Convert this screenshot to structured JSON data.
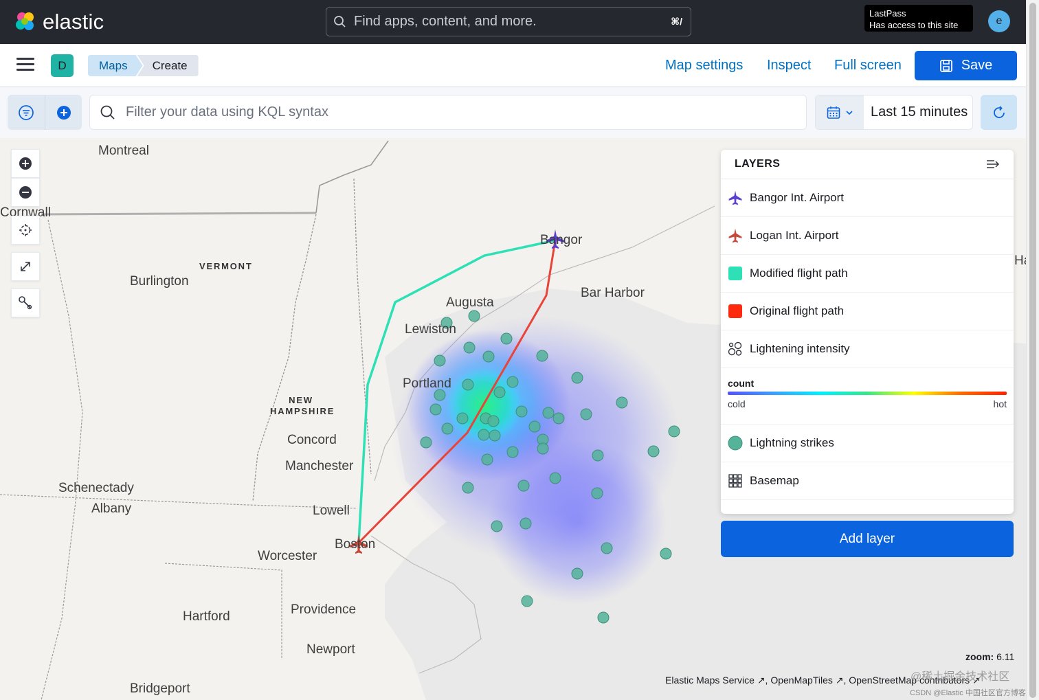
{
  "header": {
    "brand": "elastic",
    "search_placeholder": "Find apps, content, and more.",
    "search_shortcut": "⌘/",
    "lastpass_title": "LastPass",
    "lastpass_subtitle": "Has access to this site",
    "avatar_initial": "e"
  },
  "appbar": {
    "space_initial": "D",
    "breadcrumbs": [
      "Maps",
      "Create"
    ],
    "map_settings": "Map settings",
    "inspect": "Inspect",
    "full_screen": "Full screen",
    "save": "Save"
  },
  "query": {
    "kql_placeholder": "Filter your data using KQL syntax",
    "time_range": "Last 15 minutes"
  },
  "map": {
    "places": {
      "montreal": "Montreal",
      "cornwall": "Cornwall",
      "burlington": "Burlington",
      "vermont": "VERMONT",
      "new_hampshire": "NEW HAMPSHIRE",
      "concord": "Concord",
      "manchester": "Manchester",
      "schenectady": "Schenectady",
      "albany": "Albany",
      "lowell": "Lowell",
      "boston": "Boston",
      "worcester": "Worcester",
      "hartford": "Hartford",
      "providence": "Providence",
      "newport": "Newport",
      "bridgeport": "Bridgeport",
      "augusta": "Augusta",
      "lewiston": "Lewiston",
      "portland": "Portland",
      "bangor": "Bangor",
      "bar_harbor": "Bar Harbor",
      "edge_label": "Ha"
    },
    "zoom_label": "zoom:",
    "zoom_value": "6.11",
    "attribution": "Elastic Maps Service ↗, OpenMapTiles ↗, OpenStreetMap contributors ↗"
  },
  "layers_panel": {
    "title": "LAYERS",
    "layers": [
      {
        "label": "Bangor Int. Airport",
        "icon": "airplane-icon",
        "color": "#5b3fd1"
      },
      {
        "label": "Logan Int. Airport",
        "icon": "airplane-icon",
        "color": "#c8473a"
      },
      {
        "label": "Modified flight path",
        "icon": "square-swatch",
        "color": "#2de0b5"
      },
      {
        "label": "Original flight path",
        "icon": "square-swatch",
        "color": "#ff2a0d"
      },
      {
        "label": "Lightening intensity",
        "icon": "heatmap-icon",
        "color": "#343741"
      },
      {
        "label": "Lightning strikes",
        "icon": "circle-swatch",
        "color": "#54b399"
      },
      {
        "label": "Basemap",
        "icon": "grid-icon",
        "color": "#343741"
      }
    ],
    "legend": {
      "title": "count",
      "low": "cold",
      "high": "hot"
    },
    "add_layer": "Add layer"
  },
  "watermark": {
    "line1": "@稀土掘金技术社区",
    "line2": "CSDN @Elastic 中国社区官方博客"
  }
}
